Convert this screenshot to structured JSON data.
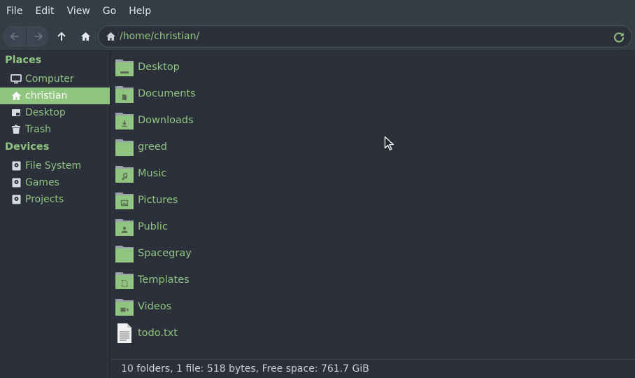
{
  "menu": [
    "File",
    "Edit",
    "View",
    "Go",
    "Help"
  ],
  "location": {
    "path": "/home/christian/"
  },
  "sidebar": {
    "places_title": "Places",
    "places": [
      {
        "label": "Computer",
        "icon": "computer-icon"
      },
      {
        "label": "christian",
        "icon": "home-icon",
        "selected": true
      },
      {
        "label": "Desktop",
        "icon": "desktop-icon"
      },
      {
        "label": "Trash",
        "icon": "trash-icon"
      }
    ],
    "devices_title": "Devices",
    "devices": [
      {
        "label": "File System",
        "icon": "drive-icon"
      },
      {
        "label": "Games",
        "icon": "drive-icon"
      },
      {
        "label": "Projects",
        "icon": "drive-icon"
      }
    ]
  },
  "files": [
    {
      "name": "Desktop",
      "type": "folder",
      "emblem": "desktop"
    },
    {
      "name": "Documents",
      "type": "folder",
      "emblem": "document"
    },
    {
      "name": "Downloads",
      "type": "folder",
      "emblem": "download"
    },
    {
      "name": "greed",
      "type": "folder",
      "emblem": "none"
    },
    {
      "name": "Music",
      "type": "folder",
      "emblem": "music"
    },
    {
      "name": "Pictures",
      "type": "folder",
      "emblem": "picture"
    },
    {
      "name": "Public",
      "type": "folder",
      "emblem": "person"
    },
    {
      "name": "Spacegray",
      "type": "folder",
      "emblem": "none"
    },
    {
      "name": "Templates",
      "type": "folder",
      "emblem": "template"
    },
    {
      "name": "Videos",
      "type": "folder",
      "emblem": "video"
    },
    {
      "name": "todo.txt",
      "type": "text-file",
      "emblem": "text"
    }
  ],
  "status": "10 folders, 1 file: 518 bytes, Free space: 761.7 GiB",
  "colors": {
    "accent": "#8fc57f",
    "background": "#2b303b",
    "toolbar": "#343d46"
  }
}
